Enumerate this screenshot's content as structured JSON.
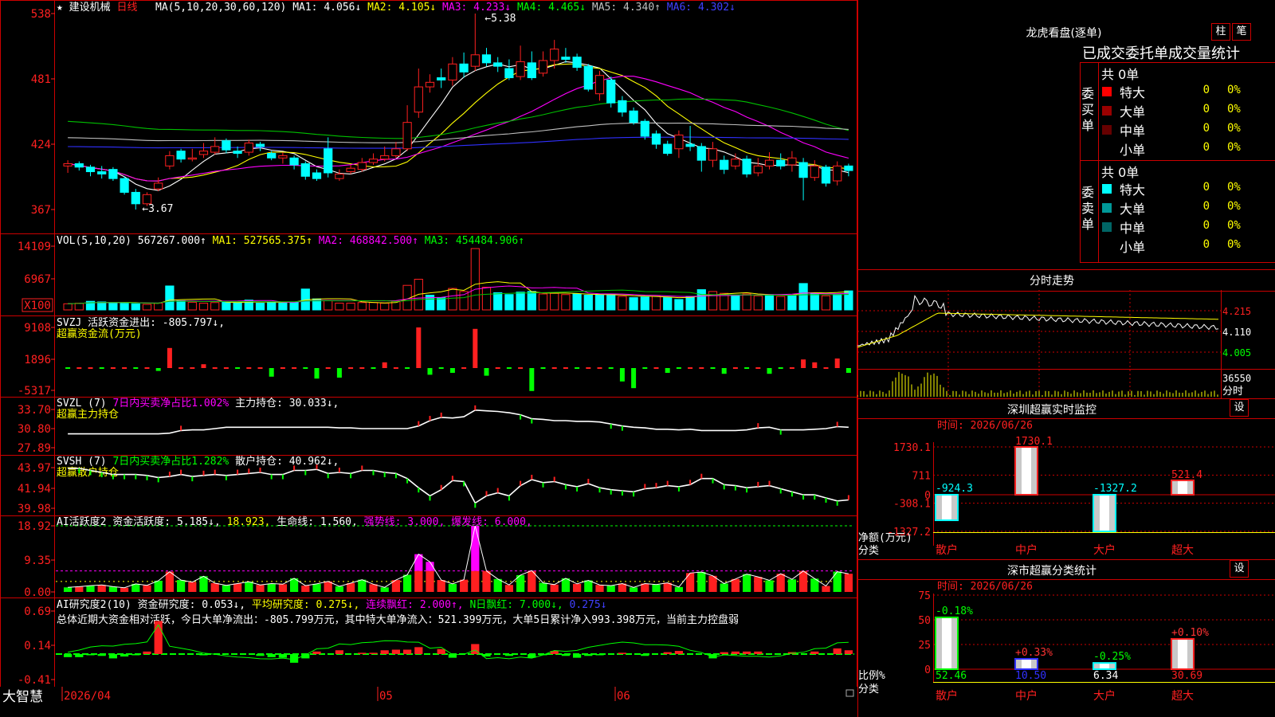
{
  "app": {
    "brand": "大智慧"
  },
  "stock": {
    "star": "★",
    "name": "建设机械",
    "period": "日线"
  },
  "ma_line": [
    {
      "t": "MA(5,10,20,30,60,120)",
      "c": "#ffffff"
    },
    {
      "t": "MA1: 4.056↓",
      "c": "#ffffff"
    },
    {
      "t": "MA2: 4.105↓",
      "c": "#ffff00"
    },
    {
      "t": "MA3: 4.233↓",
      "c": "#ff00ff"
    },
    {
      "t": "MA4: 4.465↓",
      "c": "#00ff00"
    },
    {
      "t": "MA5: 4.340↑",
      "c": "#c0c0c0"
    },
    {
      "t": "MA6: 4.302↓",
      "c": "#4040ff"
    }
  ],
  "price_axis": [
    "538",
    "481",
    "424",
    "367"
  ],
  "price_notes": {
    "high": "5.38",
    "low": "3.67"
  },
  "vol": {
    "axis": [
      "14109",
      "6967",
      "X100"
    ],
    "line": [
      {
        "t": "VOL(5,10,20)",
        "c": "#ffffff"
      },
      {
        "t": "567267.000↑",
        "c": "#ffffff"
      },
      {
        "t": "MA1: 527565.375↑",
        "c": "#ffff00"
      },
      {
        "t": "MA2: 468842.500↑",
        "c": "#ff00ff"
      },
      {
        "t": "MA3: 454484.906↑",
        "c": "#00ff00"
      }
    ]
  },
  "svzj": {
    "axis": [
      "9108",
      "1896",
      "-5317"
    ],
    "line1": [
      {
        "t": "SVZJ  活跃资金进出: -805.797↓,",
        "c": "#ffffff"
      }
    ],
    "line2": [
      {
        "t": "超赢资金流(万元)",
        "c": "#ffff00"
      }
    ]
  },
  "svzl": {
    "axis": [
      "33.70",
      "30.80",
      "27.89"
    ],
    "line1": [
      {
        "t": "SVZL (7)",
        "c": "#ffffff"
      },
      {
        "t": "7日内买卖净占比1.002%",
        "c": "#ff00ff"
      },
      {
        "t": "主力持仓: 30.033↓,",
        "c": "#ffffff"
      }
    ],
    "line2": [
      {
        "t": "超赢主力持仓",
        "c": "#ffff00"
      }
    ]
  },
  "svsh": {
    "axis": [
      "43.97",
      "41.94",
      "39.98"
    ],
    "line1": [
      {
        "t": "SVSH (7)",
        "c": "#ffffff"
      },
      {
        "t": "7日内买卖净占比1.282%",
        "c": "#00ff00"
      },
      {
        "t": "散户持仓: 40.962↓,",
        "c": "#ffffff"
      }
    ],
    "line2": [
      {
        "t": "超赢散户持仓",
        "c": "#ffff00"
      }
    ]
  },
  "ai1": {
    "axis": [
      "18.92",
      "9.35",
      "0.00"
    ],
    "line": [
      {
        "t": "AI活跃度2 资金活跃度: 5.185↓,",
        "c": "#ffffff"
      },
      {
        "t": "18.923,",
        "c": "#ffff00"
      },
      {
        "t": "生命线: 1.560,",
        "c": "#ffffff"
      },
      {
        "t": "强势线: 3.000,",
        "c": "#ff00ff"
      },
      {
        "t": "爆发线: 6.000,",
        "c": "#ff00ff"
      }
    ]
  },
  "ai2": {
    "axis": [
      "0.69",
      "0.14",
      "-0.41"
    ],
    "line1": [
      {
        "t": "AI研究度2(10) 资金研究度: 0.053↓,",
        "c": "#ffffff"
      },
      {
        "t": "平均研究度: 0.275↓,",
        "c": "#ffff00"
      },
      {
        "t": "连续飘红: 2.000↑,",
        "c": "#ff00ff"
      },
      {
        "t": "N日飘红: 7.000↓,",
        "c": "#00ff00"
      },
      {
        "t": "0.275↓",
        "c": "#4040ff"
      }
    ],
    "line2": "总体近期大资金相对活跃，今日大单净流出：-805.799万元，其中特大单净流入：521.399万元，大单5日累计净入993.398万元，当前主力控盘弱"
  },
  "date_axis": [
    "2026/04",
    "05",
    "06"
  ],
  "longhu": {
    "title": "龙虎看盘(逐单)",
    "btn_zhu": "柱",
    "btn_bi": "笔",
    "header": "已成交委托单成交量统计",
    "buy": {
      "label": "委买单",
      "total": "共 0单",
      "rows": [
        {
          "name": "特大",
          "val": "0",
          "pct": "0%",
          "color": "#ff0000"
        },
        {
          "name": "大单",
          "val": "0",
          "pct": "0%",
          "color": "#990000"
        },
        {
          "name": "中单",
          "val": "0",
          "pct": "0%",
          "color": "#660000"
        },
        {
          "name": "小单",
          "val": "0",
          "pct": "0%",
          "color": "#000000"
        }
      ]
    },
    "sell": {
      "label": "委卖单",
      "total": "共 0单",
      "rows": [
        {
          "name": "特大",
          "val": "0",
          "pct": "0%",
          "color": "#00ffff"
        },
        {
          "name": "大单",
          "val": "0",
          "pct": "0%",
          "color": "#009999"
        },
        {
          "name": "中单",
          "val": "0",
          "pct": "0%",
          "color": "#006666"
        },
        {
          "name": "小单",
          "val": "0",
          "pct": "0%",
          "color": "#000000"
        }
      ]
    }
  },
  "intraday": {
    "title": "分时走势",
    "axis": [
      "4.215",
      "4.110",
      "4.005"
    ],
    "vol_axis": "36550",
    "unit": "分时"
  },
  "monitor": {
    "title": "深圳超赢实时监控",
    "btn": "设",
    "time": "时间: 2026/06/26",
    "axis": [
      "1730.1",
      "711",
      "0",
      "-308.1",
      "-1327.2"
    ],
    "ylabel": "净额(万元)",
    "xlabel": "分类",
    "cats": [
      "散户",
      "中户",
      "大户",
      "超大"
    ],
    "values": [
      -924.3,
      1730.1,
      -1327.2,
      521.4
    ],
    "labels": [
      "-924.3",
      "1730.1",
      "-1327.2",
      "521.4"
    ]
  },
  "classify": {
    "title": "深市超赢分类统计",
    "btn": "设",
    "time": "时间: 2026/06/26",
    "axis": [
      "75",
      "50",
      "25",
      "0"
    ],
    "ylabel": "比例%",
    "xlabel": "分类",
    "cats": [
      "散户",
      "中户",
      "大户",
      "超大"
    ],
    "ratios": [
      52.46,
      10.5,
      6.34,
      30.69
    ],
    "ratio_labels": [
      "52.46",
      "10.50",
      "6.34",
      "30.69"
    ],
    "changes": [
      "-0.18%",
      "+0.33%",
      "-0.25%",
      "+0.10%"
    ],
    "change_colors": [
      "#00ff00",
      "#ff3333",
      "#00ff00",
      "#ff3333"
    ]
  },
  "colors": {
    "up": "#ff2020",
    "down": "#00ffff",
    "frame": "#cc0000",
    "green": "#00ff00",
    "magenta": "#ff00ff"
  },
  "chart_data": {
    "type": "candlestick",
    "candles": [
      [
        4.05,
        4.07,
        4.1,
        3.99
      ],
      [
        4.07,
        4.04,
        4.09,
        4.01
      ],
      [
        4.04,
        4.0,
        4.06,
        3.96
      ],
      [
        4.0,
        3.98,
        4.05,
        3.94
      ],
      [
        4.02,
        3.94,
        4.04,
        3.92
      ],
      [
        3.94,
        3.82,
        3.96,
        3.8
      ],
      [
        3.82,
        3.72,
        3.85,
        3.67
      ],
      [
        3.72,
        3.8,
        3.82,
        3.7
      ],
      [
        3.85,
        3.9,
        3.95,
        3.83
      ],
      [
        4.05,
        4.14,
        4.18,
        4.02
      ],
      [
        4.18,
        4.11,
        4.2,
        4.08
      ],
      [
        4.12,
        4.12,
        4.2,
        4.09
      ],
      [
        4.15,
        4.18,
        4.25,
        4.12
      ],
      [
        4.17,
        4.22,
        4.3,
        4.15
      ],
      [
        4.27,
        4.19,
        4.29,
        4.16
      ],
      [
        4.18,
        4.16,
        4.22,
        4.12
      ],
      [
        4.17,
        4.25,
        4.28,
        4.14
      ],
      [
        4.24,
        4.22,
        4.26,
        4.18
      ],
      [
        4.16,
        4.12,
        4.18,
        4.1
      ],
      [
        4.12,
        4.14,
        4.17,
        4.07
      ],
      [
        4.12,
        4.06,
        4.14,
        4.02
      ],
      [
        4.07,
        3.96,
        4.09,
        3.93
      ],
      [
        3.99,
        3.94,
        4.02,
        3.92
      ],
      [
        4.2,
        3.99,
        4.3,
        3.95
      ],
      [
        3.94,
        3.98,
        4.02,
        3.92
      ],
      [
        4.0,
        4.03,
        4.06,
        3.98
      ],
      [
        4.02,
        4.08,
        4.12,
        4.0
      ],
      [
        4.08,
        4.11,
        4.16,
        4.06
      ],
      [
        4.11,
        4.14,
        4.22,
        4.09
      ],
      [
        4.14,
        4.2,
        4.26,
        4.12
      ],
      [
        4.2,
        4.43,
        4.58,
        4.18
      ],
      [
        4.52,
        4.74,
        4.9,
        4.47
      ],
      [
        4.74,
        4.78,
        4.85,
        4.69
      ],
      [
        4.82,
        4.8,
        4.9,
        4.73
      ],
      [
        4.8,
        4.94,
        5.0,
        4.75
      ],
      [
        4.94,
        4.87,
        5.04,
        4.82
      ],
      [
        4.92,
        5.02,
        5.38,
        4.88
      ],
      [
        5.02,
        4.95,
        5.08,
        4.92
      ],
      [
        4.95,
        4.92,
        5.0,
        4.87
      ],
      [
        4.9,
        4.82,
        4.98,
        4.8
      ],
      [
        4.83,
        4.96,
        5.1,
        4.8
      ],
      [
        4.95,
        4.82,
        5.05,
        4.8
      ],
      [
        4.86,
        4.97,
        5.05,
        4.83
      ],
      [
        4.97,
        5.07,
        5.15,
        4.9
      ],
      [
        5.0,
        4.98,
        5.08,
        4.95
      ],
      [
        5.0,
        4.91,
        5.03,
        4.88
      ],
      [
        4.92,
        4.72,
        4.94,
        4.7
      ],
      [
        4.68,
        4.84,
        4.88,
        4.62
      ],
      [
        4.8,
        4.6,
        4.83,
        4.56
      ],
      [
        4.62,
        4.52,
        4.66,
        4.48
      ],
      [
        4.53,
        4.43,
        4.56,
        4.41
      ],
      [
        4.44,
        4.31,
        4.46,
        4.28
      ],
      [
        4.33,
        4.24,
        4.36,
        4.2
      ],
      [
        4.24,
        4.16,
        4.27,
        4.14
      ],
      [
        4.2,
        4.32,
        4.36,
        4.12
      ],
      [
        4.24,
        4.22,
        4.4,
        4.18
      ],
      [
        4.22,
        4.1,
        4.25,
        4.0
      ],
      [
        4.1,
        4.2,
        4.26,
        4.04
      ],
      [
        4.1,
        4.02,
        4.14,
        3.98
      ],
      [
        4.05,
        4.11,
        4.16,
        4.02
      ],
      [
        4.11,
        3.98,
        4.14,
        3.95
      ],
      [
        3.99,
        4.05,
        4.12,
        3.96
      ],
      [
        4.05,
        4.1,
        4.17,
        4.02
      ],
      [
        4.1,
        4.05,
        4.16,
        4.02
      ],
      [
        4.06,
        4.12,
        4.18,
        4.0
      ],
      [
        4.08,
        3.95,
        4.12,
        3.75
      ],
      [
        3.95,
        4.05,
        4.1,
        3.92
      ],
      [
        4.04,
        3.9,
        4.06,
        3.87
      ],
      [
        3.92,
        4.05,
        4.09,
        3.88
      ],
      [
        4.05,
        4.01,
        4.07,
        3.96
      ]
    ],
    "volume": [
      [
        20,
        "u"
      ],
      [
        22,
        "u"
      ],
      [
        28,
        "d"
      ],
      [
        26,
        "d"
      ],
      [
        24,
        "d"
      ],
      [
        22,
        "d"
      ],
      [
        20,
        "d"
      ],
      [
        18,
        "u"
      ],
      [
        22,
        "u"
      ],
      [
        78,
        "d"
      ],
      [
        30,
        "d"
      ],
      [
        25,
        "u"
      ],
      [
        22,
        "u"
      ],
      [
        24,
        "u"
      ],
      [
        26,
        "d"
      ],
      [
        24,
        "d"
      ],
      [
        32,
        "d"
      ],
      [
        22,
        "d"
      ],
      [
        24,
        "d"
      ],
      [
        22,
        "d"
      ],
      [
        26,
        "d"
      ],
      [
        68,
        "d"
      ],
      [
        36,
        "d"
      ],
      [
        30,
        "u"
      ],
      [
        22,
        "u"
      ],
      [
        22,
        "u"
      ],
      [
        24,
        "u"
      ],
      [
        24,
        "u"
      ],
      [
        22,
        "u"
      ],
      [
        28,
        "u"
      ],
      [
        80,
        "u"
      ],
      [
        100,
        "u"
      ],
      [
        48,
        "d"
      ],
      [
        40,
        "d"
      ],
      [
        70,
        "u"
      ],
      [
        60,
        "u"
      ],
      [
        200,
        "u"
      ],
      [
        74,
        "u"
      ],
      [
        56,
        "d"
      ],
      [
        50,
        "d"
      ],
      [
        58,
        "d"
      ],
      [
        60,
        "d"
      ],
      [
        52,
        "u"
      ],
      [
        54,
        "u"
      ],
      [
        50,
        "u"
      ],
      [
        52,
        "d"
      ],
      [
        48,
        "d"
      ],
      [
        48,
        "d"
      ],
      [
        50,
        "d"
      ],
      [
        44,
        "u"
      ],
      [
        40,
        "d"
      ],
      [
        42,
        "d"
      ],
      [
        44,
        "u"
      ],
      [
        40,
        "d"
      ],
      [
        34,
        "d"
      ],
      [
        44,
        "d"
      ],
      [
        66,
        "d"
      ],
      [
        60,
        "u"
      ],
      [
        54,
        "u"
      ],
      [
        48,
        "d"
      ],
      [
        52,
        "u"
      ],
      [
        46,
        "u"
      ],
      [
        50,
        "d"
      ],
      [
        44,
        "u"
      ],
      [
        48,
        "d"
      ],
      [
        86,
        "d"
      ],
      [
        52,
        "d"
      ],
      [
        46,
        "u"
      ],
      [
        52,
        "d"
      ],
      [
        62,
        "d"
      ]
    ],
    "svzj": [
      0,
      0,
      0,
      0,
      0,
      0,
      0,
      0,
      -6,
      42,
      0,
      0,
      8,
      0,
      0,
      0,
      0,
      0,
      -18,
      0,
      0,
      0,
      -22,
      0,
      -20,
      0,
      0,
      0,
      12,
      0,
      0,
      85,
      -14,
      0,
      -10,
      0,
      82,
      -16,
      0,
      0,
      0,
      -48,
      0,
      0,
      0,
      0,
      0,
      0,
      0,
      -28,
      -42,
      0,
      0,
      -10,
      0,
      0,
      0,
      0,
      -12,
      0,
      0,
      0,
      -12,
      0,
      0,
      18,
      12,
      0,
      20,
      -10
    ],
    "zl": [
      30.0,
      30.0,
      30.0,
      30.0,
      30.0,
      30.0,
      30.0,
      30.0,
      30.0,
      30.1,
      30.5,
      30.6,
      30.6,
      30.8,
      31.0,
      31.0,
      31.0,
      31.0,
      31.0,
      31.0,
      31.0,
      31.0,
      31.0,
      31.0,
      30.9,
      30.9,
      30.8,
      30.8,
      30.8,
      30.8,
      30.8,
      31.2,
      32.0,
      32.5,
      32.4,
      32.6,
      33.6,
      33.5,
      33.4,
      33.2,
      32.9,
      32.3,
      32.2,
      32.0,
      32.0,
      31.9,
      31.9,
      31.8,
      31.5,
      31.2,
      31.0,
      30.9,
      30.7,
      30.7,
      30.6,
      30.7,
      30.5,
      30.5,
      30.5,
      30.5,
      30.6,
      30.9,
      31.0,
      30.6,
      30.6,
      30.6,
      30.7,
      30.8,
      31.1,
      31.0
    ],
    "sh": [
      43.9,
      43.9,
      43.7,
      43.5,
      43.3,
      43.3,
      43.3,
      43.2,
      43.0,
      43.1,
      43.3,
      43.1,
      43.2,
      43.3,
      43.2,
      43.3,
      43.4,
      43.5,
      43.3,
      43.3,
      43.7,
      43.7,
      43.8,
      43.4,
      43.5,
      43.4,
      43.7,
      43.7,
      43.5,
      43.4,
      42.9,
      42.0,
      41.2,
      41.8,
      42.7,
      42.6,
      40.5,
      41.2,
      41.5,
      41.2,
      42.2,
      42.8,
      42.5,
      42.6,
      42.3,
      42.1,
      42.4,
      42.0,
      41.8,
      41.7,
      41.6,
      41.9,
      42.0,
      42.2,
      42.1,
      42.3,
      42.9,
      42.9,
      42.3,
      42.2,
      42.0,
      42.1,
      42.2,
      41.9,
      41.6,
      41.3,
      41.3,
      41.0,
      40.7,
      40.8
    ],
    "ai1": [
      1.3,
      1.5,
      1.8,
      2.0,
      1.5,
      1.2,
      2.3,
      1.9,
      3.2,
      5.8,
      3.4,
      2.8,
      4.5,
      2.5,
      1.9,
      2.4,
      2.9,
      2.0,
      2.4,
      2.2,
      3.9,
      1.8,
      2.3,
      3.0,
      1.6,
      2.5,
      3.5,
      2.2,
      1.3,
      3.4,
      4.9,
      10.8,
      8.6,
      3.4,
      2.3,
      3.5,
      18.9,
      6.0,
      3.7,
      2.0,
      4.8,
      6.1,
      2.6,
      2.1,
      3.9,
      2.3,
      3.3,
      2.0,
      1.8,
      2.4,
      1.3,
      2.4,
      2.1,
      2.6,
      1.4,
      5.4,
      5.7,
      4.6,
      2.4,
      3.7,
      5.1,
      4.3,
      3.3,
      5.2,
      3.6,
      6.0,
      3.8,
      1.7,
      5.8,
      5.2
    ],
    "ai2": [
      -0.05,
      -0.05,
      -0.02,
      -0.03,
      -0.07,
      -0.04,
      -0.02,
      0.04,
      0.53,
      0.0,
      0.0,
      0.0,
      -0.02,
      0.0,
      0.0,
      0.0,
      0.0,
      -0.03,
      -0.05,
      -0.06,
      -0.14,
      -0.07,
      0.04,
      0.0,
      0.06,
      0.0,
      0.02,
      0.02,
      0.06,
      0.07,
      0.07,
      0.11,
      0.0,
      0.08,
      -0.06,
      0.0,
      0.16,
      -0.04,
      0.0,
      -0.03,
      0.0,
      -0.06,
      -0.02,
      0.05,
      -0.03,
      -0.06,
      -0.03,
      -0.02,
      0.0,
      0.02,
      0.0,
      -0.03,
      0.0,
      0.03,
      0.05,
      0.0,
      0.0,
      -0.07,
      0.03,
      0.04,
      0.04,
      0.04,
      0.0,
      0.0,
      0.03,
      0.0,
      0.04,
      0.0,
      0.09,
      0.06
    ]
  }
}
